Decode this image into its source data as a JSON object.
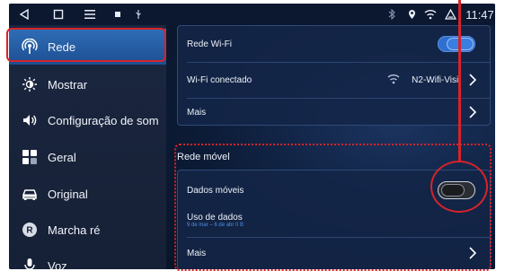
{
  "statusbar": {
    "time": "11:47",
    "icons": [
      "back-icon",
      "home-icon",
      "menu-icon",
      "square-icon",
      "usb-icon",
      "bluetooth-icon",
      "location-icon",
      "wifi-icon",
      "warning-icon"
    ]
  },
  "sidebar": {
    "items": [
      {
        "label": "Rede",
        "icon": "network-icon",
        "active": true
      },
      {
        "label": "Mostrar",
        "icon": "brightness-icon"
      },
      {
        "label": "Configuração de som",
        "icon": "speaker-icon"
      },
      {
        "label": "Geral",
        "icon": "apps-icon"
      },
      {
        "label": "Original",
        "icon": "car-icon"
      },
      {
        "label": "Marcha ré",
        "icon": "reverse-icon"
      },
      {
        "label": "Voz",
        "icon": "mic-icon"
      }
    ]
  },
  "wifi_card": {
    "rede_wifi": "Rede Wi-Fi",
    "rede_wifi_toggle": "on",
    "conectado_label": "Wi-Fi conectado",
    "conectado_value": "N2-Wifi-Visit",
    "mais": "Mais"
  },
  "mobile": {
    "section_title": "Rede móvel",
    "dados_moveis": "Dados móveis",
    "dados_moveis_toggle": "off",
    "uso_dados": "Uso de dados",
    "uso_dados_sub": "9 de mar – 6 de abr 0 B",
    "mais": "Mais"
  },
  "colors": {
    "highlight": "#d8232a",
    "accent": "#2e6fd0"
  }
}
